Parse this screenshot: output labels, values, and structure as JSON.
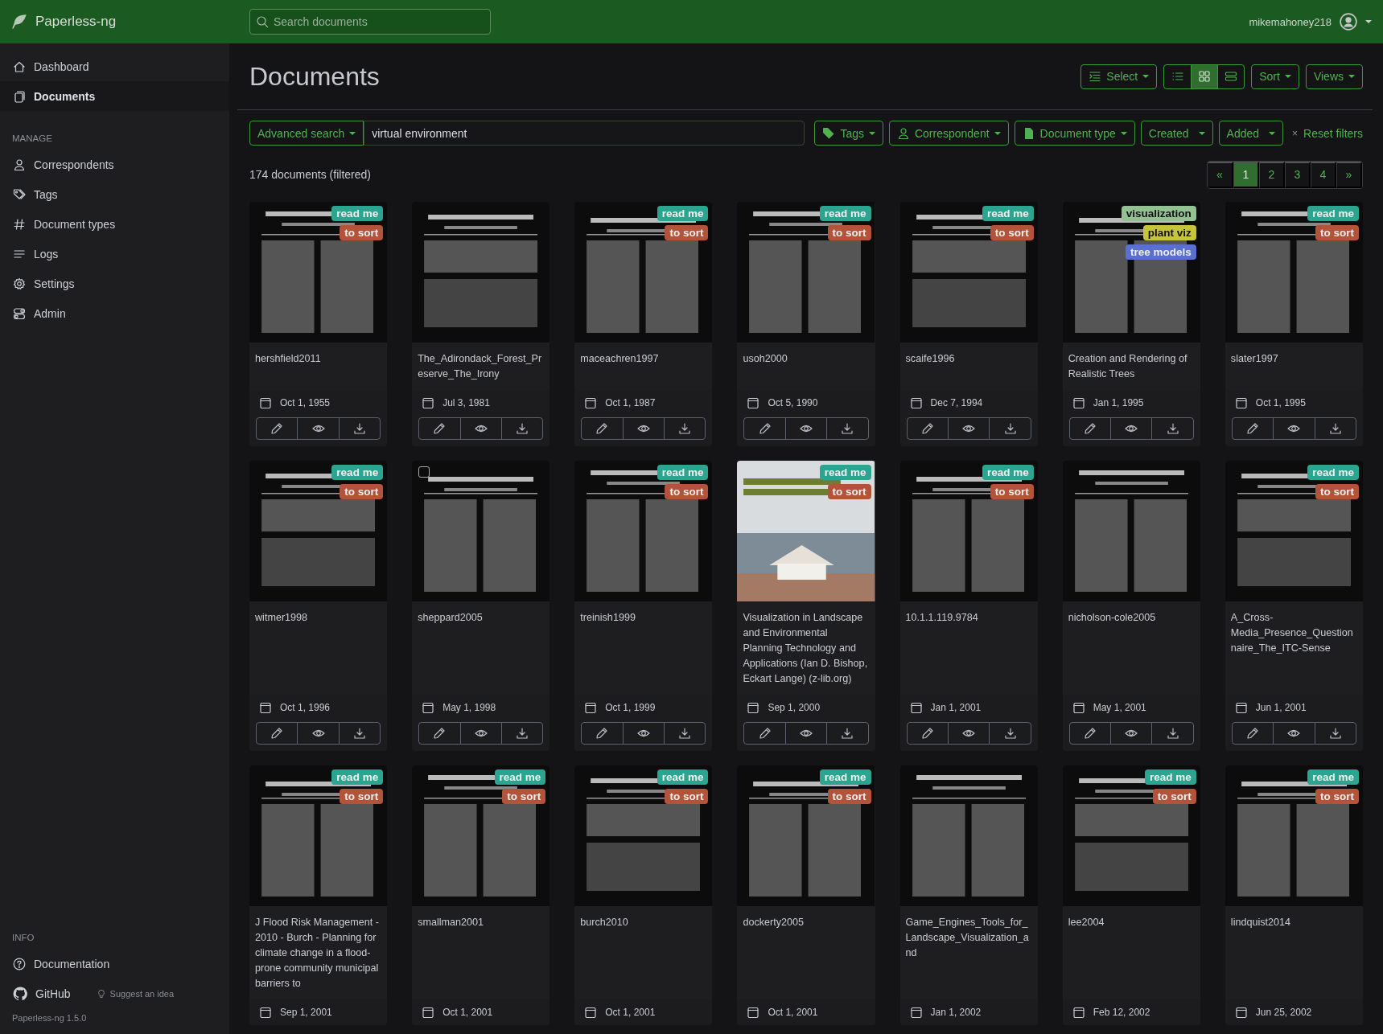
{
  "app": {
    "brand": "Paperless-ng",
    "search": {
      "placeholder": "Search documents"
    },
    "user": "mikemahoney218"
  },
  "sidebar": {
    "nav": [
      {
        "label": "Dashboard",
        "selected": false
      },
      {
        "label": "Documents",
        "selected": true
      }
    ],
    "manage_heading": "MANAGE",
    "manage": [
      {
        "label": "Correspondents",
        "selected": false
      },
      {
        "label": "Tags",
        "selected": false
      },
      {
        "label": "Document types",
        "selected": false
      },
      {
        "label": "Logs",
        "selected": false
      },
      {
        "label": "Settings",
        "selected": false
      },
      {
        "label": "Admin",
        "selected": false
      }
    ],
    "info_heading": "INFO",
    "info": [
      {
        "label": "Documentation"
      },
      {
        "label": "GitHub"
      }
    ],
    "suggest": "Suggest an idea",
    "version": "Paperless-ng 1.5.0"
  },
  "page": {
    "title": "Documents",
    "select_button": "Select",
    "views": [
      {
        "selected": false
      },
      {
        "selected": true
      },
      {
        "selected": false
      }
    ],
    "sort_button": "Sort",
    "views_button": "Views"
  },
  "filters": {
    "mode": "Advanced search",
    "query": "virtual environment",
    "buttons": [
      {
        "label": "Tags"
      },
      {
        "label": "Correspondent"
      },
      {
        "label": "Document type"
      },
      {
        "label": "Created"
      },
      {
        "label": "Added"
      }
    ],
    "reset": {
      "icon": "×",
      "label": "Reset filters"
    }
  },
  "count": "174 documents (filtered)",
  "pagination": [
    {
      "label": "«",
      "selected": false
    },
    {
      "label": "1",
      "selected": true
    },
    {
      "label": "2",
      "selected": false
    },
    {
      "label": "3",
      "selected": false
    },
    {
      "label": "4",
      "selected": false
    },
    {
      "label": "»",
      "selected": false
    }
  ],
  "documents": [
    {
      "title": "hershfield2011",
      "date": "Oct 1, 1955",
      "tags": [
        {
          "label": "read me",
          "color": "#2ba58f"
        },
        {
          "label": "to sort",
          "color": "#b3533a"
        }
      ],
      "actions": true
    },
    {
      "title": "The_Adirondack_Forest_Preserve_The_Irony",
      "date": "Jul 3, 1981",
      "actions": true
    },
    {
      "title": "maceachren1997",
      "date": "Oct 1, 1987",
      "tags": [
        {
          "label": "read me",
          "color": "#2ba58f"
        },
        {
          "label": "to sort",
          "color": "#b3533a"
        }
      ],
      "actions": true
    },
    {
      "title": "usoh2000",
      "date": "Oct 5, 1990",
      "tags": [
        {
          "label": "read me",
          "color": "#2ba58f"
        },
        {
          "label": "to sort",
          "color": "#b3533a"
        }
      ],
      "actions": true
    },
    {
      "title": "scaife1996",
      "date": "Dec 7, 1994",
      "tags": [
        {
          "label": "read me",
          "color": "#2ba58f"
        },
        {
          "label": "to sort",
          "color": "#b3533a"
        }
      ],
      "actions": true
    },
    {
      "title": "Creation and Rendering of Realistic Trees",
      "date": "Jan 1, 1995",
      "tags": [
        {
          "label": "visualization",
          "color": "#93c193"
        },
        {
          "label": "plant viz",
          "color": "#c6c43a"
        },
        {
          "label": "tree models",
          "color": "#5a6fcf"
        }
      ],
      "actions": true
    },
    {
      "title": "slater1997",
      "date": "Oct 1, 1995",
      "tags": [
        {
          "label": "read me",
          "color": "#2ba58f"
        },
        {
          "label": "to sort",
          "color": "#b3533a"
        }
      ],
      "actions": true
    },
    {
      "title": "witmer1998",
      "date": "Oct 1, 1996",
      "tags": [
        {
          "label": "read me",
          "color": "#2ba58f"
        },
        {
          "label": "to sort",
          "color": "#b3533a"
        }
      ],
      "actions": true
    },
    {
      "title": "sheppard2005",
      "date": "May 1, 1998",
      "checkbox": {
        "checked": false
      },
      "actions": true
    },
    {
      "title": "treinish1999",
      "date": "Oct 1, 1999",
      "tags": [
        {
          "label": "read me",
          "color": "#2ba58f"
        },
        {
          "label": "to sort",
          "color": "#b3533a"
        }
      ],
      "actions": true
    },
    {
      "title": "Visualization in Landscape and Environmental Planning Technology and Applications (Ian D. Bishop, Eckart Lange) (z-lib.org)",
      "date": "Sep 1, 2000",
      "tags": [
        {
          "label": "read me",
          "color": "#2ba58f"
        },
        {
          "label": "to sort",
          "color": "#b3533a"
        }
      ],
      "actions": true
    },
    {
      "title": "10.1.1.119.9784",
      "date": "Jan 1, 2001",
      "tags": [
        {
          "label": "read me",
          "color": "#2ba58f"
        },
        {
          "label": "to sort",
          "color": "#b3533a"
        }
      ],
      "actions": true
    },
    {
      "title": "nicholson-cole2005",
      "date": "May 1, 2001",
      "actions": true
    },
    {
      "title": "A_Cross-Media_Presence_Questionnaire_The_ITC-Sense",
      "date": "Jun 1, 2001",
      "tags": [
        {
          "label": "read me",
          "color": "#2ba58f"
        },
        {
          "label": "to sort",
          "color": "#b3533a"
        }
      ],
      "actions": true
    },
    {
      "title": "J Flood Risk Management - 2010 - Burch - Planning for climate change in a flood-prone community municipal barriers to",
      "date": "Sep 1, 2001",
      "tags": [
        {
          "label": "read me",
          "color": "#2ba58f"
        },
        {
          "label": "to sort",
          "color": "#b3533a"
        }
      ],
      "actions": false
    },
    {
      "title": "smallman2001",
      "date": "Oct 1, 2001",
      "tags": [
        {
          "label": "read me",
          "color": "#2ba58f"
        },
        {
          "label": "to sort",
          "color": "#b3533a"
        }
      ],
      "actions": false
    },
    {
      "title": "burch2010",
      "date": "Oct 1, 2001",
      "tags": [
        {
          "label": "read me",
          "color": "#2ba58f"
        },
        {
          "label": "to sort",
          "color": "#b3533a"
        }
      ],
      "actions": false
    },
    {
      "title": "dockerty2005",
      "date": "Oct 1, 2001",
      "tags": [
        {
          "label": "read me",
          "color": "#2ba58f"
        },
        {
          "label": "to sort",
          "color": "#b3533a"
        }
      ],
      "actions": false
    },
    {
      "title": "Game_Engines_Tools_for_Landscape_Visualization_and",
      "date": "Jan 1, 2002",
      "actions": false
    },
    {
      "title": "lee2004",
      "date": "Feb 12, 2002",
      "tags": [
        {
          "label": "read me",
          "color": "#2ba58f"
        },
        {
          "label": "to sort",
          "color": "#b3533a"
        }
      ],
      "actions": false
    },
    {
      "title": "lindquist2014",
      "date": "Jun 25, 2002",
      "tags": [
        {
          "label": "read me",
          "color": "#2ba58f"
        },
        {
          "label": "to sort",
          "color": "#b3533a"
        }
      ],
      "actions": false
    }
  ]
}
